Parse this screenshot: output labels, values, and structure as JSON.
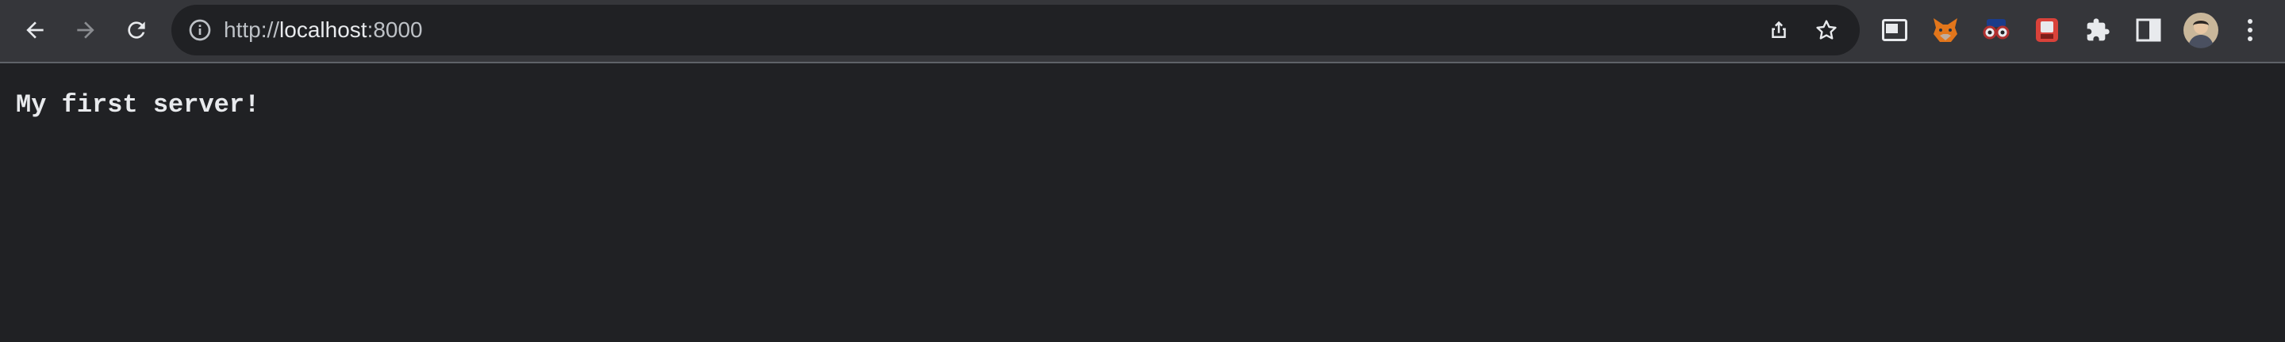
{
  "browser": {
    "url_scheme": "http://",
    "url_host": "localhost",
    "url_port": ":8000",
    "icons": {
      "back": "back-arrow-icon",
      "forward": "forward-arrow-icon",
      "reload": "reload-icon",
      "site_info": "info-icon",
      "share": "share-icon",
      "bookmark": "star-icon",
      "extensions": [
        "picture-in-picture-icon",
        "fox-extension-icon",
        "glasses-extension-icon",
        "red-extension-icon",
        "puzzle-icon",
        "side-panel-icon",
        "profile-avatar",
        "kebab-menu-icon"
      ]
    }
  },
  "page": {
    "body_text": "My first server!"
  },
  "colors": {
    "toolbar": "#35363a",
    "omnibox": "#202124",
    "page_background": "#202124",
    "text": "#e8eaed"
  }
}
